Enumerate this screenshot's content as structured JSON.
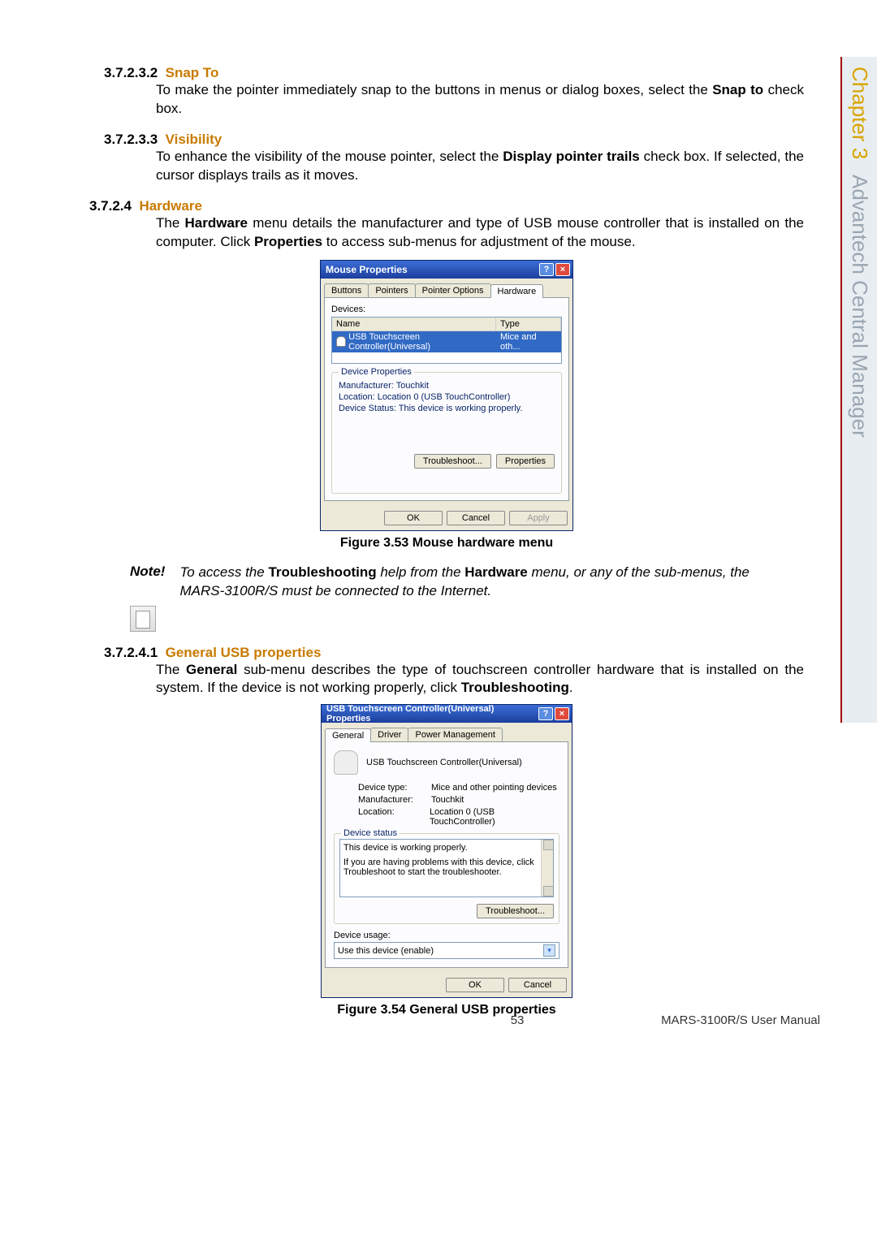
{
  "sidebar": {
    "chapter": "Chapter 3",
    "title": "Advantech Central Manager"
  },
  "s1": {
    "num": "3.7.2.3.2",
    "title": "Snap To",
    "body_pre": "To make the pointer immediately snap to the buttons in menus or dialog boxes, select the ",
    "body_bold": "Snap to",
    "body_post": " check box."
  },
  "s2": {
    "num": "3.7.2.3.3",
    "title": "Visibility",
    "body_pre": "To enhance the visibility of the mouse pointer, select the ",
    "body_bold": "Display pointer trails",
    "body_post": " check box. If selected, the cursor displays trails as it moves."
  },
  "s3": {
    "num": "3.7.2.4",
    "title": "Hardware",
    "body_pre": "The ",
    "body_b1": "Hardware",
    "body_mid": " menu details the manufacturer and type of USB mouse controller that is installed on the computer. Click ",
    "body_b2": "Properties",
    "body_post": " to access sub-menus for adjustment of the mouse."
  },
  "dialog1": {
    "title": "Mouse Properties",
    "tabs": [
      "Buttons",
      "Pointers",
      "Pointer Options",
      "Hardware"
    ],
    "devices_label": "Devices:",
    "col_name": "Name",
    "col_type": "Type",
    "dev_name": "USB Touchscreen Controller(Universal)",
    "dev_type": "Mice and oth...",
    "group_title": "Device Properties",
    "manufacturer": "Manufacturer: Touchkit",
    "location": "Location: Location 0 (USB TouchController)",
    "status": "Device Status: This device is working properly.",
    "troubleshoot": "Troubleshoot...",
    "properties": "Properties",
    "ok": "OK",
    "cancel": "Cancel",
    "apply": "Apply"
  },
  "fig1": "Figure 3.53 Mouse hardware menu",
  "note": {
    "label": "Note!",
    "pre": "To access the ",
    "b1": "Troubleshooting",
    "mid": " help from the ",
    "b2": "Hardware",
    "post": " menu, or any of the sub-menus, the MARS-3100R/S must be connected to the Internet."
  },
  "s4": {
    "num": "3.7.2.4.1",
    "title": "General USB properties",
    "body_pre": "The ",
    "body_b1": "General",
    "body_mid": " sub-menu describes the type of touchscreen controller hardware that is installed on the system. If the device is not working properly, click ",
    "body_b2": "Troubleshooting",
    "body_post": "."
  },
  "dialog2": {
    "title": "USB Touchscreen Controller(Universal) Properties",
    "tabs": [
      "General",
      "Driver",
      "Power Management"
    ],
    "dev_name": "USB Touchscreen Controller(Universal)",
    "dt_label": "Device type:",
    "dt_val": "Mice and other pointing devices",
    "mf_label": "Manufacturer:",
    "mf_val": "Touchkit",
    "loc_label": "Location:",
    "loc_val": "Location 0 (USB TouchController)",
    "status_title": "Device status",
    "status_line1": "This device is working properly.",
    "status_line2": "If you are having problems with this device, click Troubleshoot to start the troubleshooter.",
    "troubleshoot": "Troubleshoot...",
    "usage_label": "Device usage:",
    "usage_value": "Use this device (enable)",
    "ok": "OK",
    "cancel": "Cancel"
  },
  "fig2": "Figure 3.54 General USB properties",
  "footer": {
    "page": "53",
    "manual": "MARS-3100R/S User Manual"
  }
}
